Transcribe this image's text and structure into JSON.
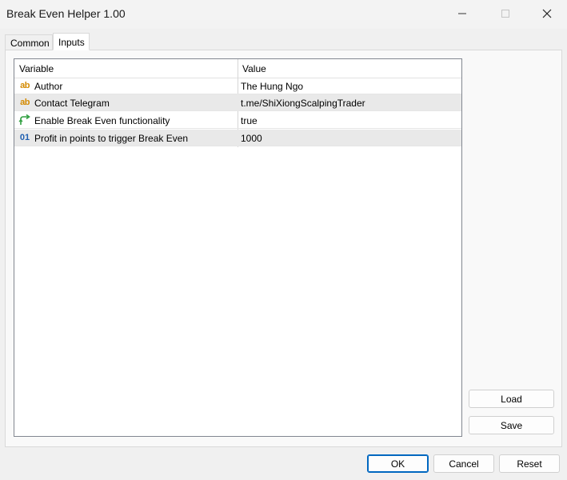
{
  "window": {
    "title": "Break Even Helper 1.00",
    "controls": [
      "minimize-icon",
      "maximize-icon",
      "close-icon"
    ]
  },
  "tabs": [
    {
      "label": "Common",
      "active": false
    },
    {
      "label": "Inputs",
      "active": true
    }
  ],
  "grid": {
    "columns": [
      "Variable",
      "Value"
    ],
    "rows": [
      {
        "icon": "string-type-icon",
        "icon_text": "ab",
        "variable": "Author",
        "value": "The Hung Ngo"
      },
      {
        "icon": "string-type-icon",
        "icon_text": "ab",
        "variable": "Contact Telegram",
        "value": "t.me/ShiXiongScalpingTrader"
      },
      {
        "icon": "boolean-type-icon",
        "icon_text": "",
        "variable": "Enable Break Even functionality",
        "value": "true"
      },
      {
        "icon": "integer-type-icon",
        "icon_text": "01",
        "variable": "Profit in points to trigger Break Even",
        "value": "1000"
      }
    ]
  },
  "side_buttons": {
    "load": "Load",
    "save": "Save"
  },
  "footer_buttons": {
    "ok": "OK",
    "cancel": "Cancel",
    "reset": "Reset"
  },
  "colors": {
    "string_icon": "#d48a00",
    "bool_icon": "#2e9e3e",
    "int_icon": "#1f5fb0",
    "ok_border": "#0067c0"
  }
}
